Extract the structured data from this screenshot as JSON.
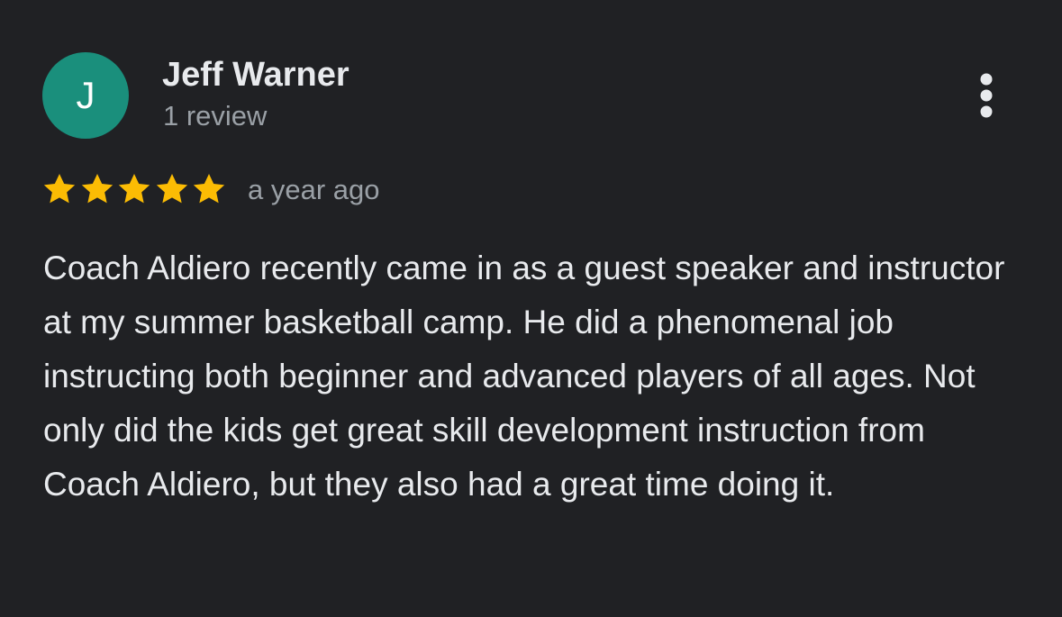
{
  "review": {
    "avatar_initial": "J",
    "avatar_color": "#1a8f7c",
    "reviewer_name": "Jeff Warner",
    "review_count": "1 review",
    "rating": 5,
    "rating_max": 5,
    "star_color": "#fbbc04",
    "date": "a year ago",
    "text": "Coach Aldiero recently came in as a guest speaker and instructor at my summer basketball camp. He did a phenomenal job instructing both beginner and advanced players of all ages. Not only did the kids get great skill development instruction from Coach Aldiero, but they also had a great time doing it.",
    "menu_icon": "more-vert-icon"
  }
}
